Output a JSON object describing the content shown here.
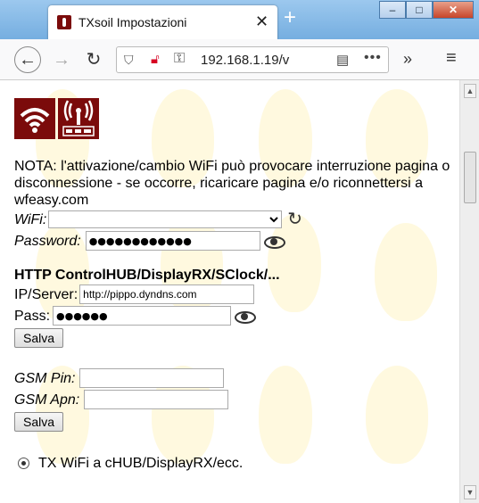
{
  "browser": {
    "tab_title": "TXsoil Impostazioni",
    "tab_close": "✕",
    "new_tab": "+",
    "url": "192.168.1.19/v",
    "win_minimize": "–",
    "win_maximize": "□",
    "win_close": "✕"
  },
  "page": {
    "note": "NOTA: l'attivazione/cambio WiFi può provocare interruzione pagina o disconnessione - se occorre, ricaricare pagina e/o riconnettersi a wfeasy.com",
    "wifi_label": "WiFi:",
    "wifi_value": "",
    "password_label": "Password:",
    "password_value": "●●●●●●●●●●●●",
    "http_heading": "HTTP ControlHUB/DisplayRX/SClock/...",
    "ip_label": "IP/Server:",
    "ip_value": "http://pippo.dyndns.com",
    "pass_label": "Pass:",
    "pass_value": "●●●●●●",
    "save_label": "Salva",
    "gsm_pin_label": "GSM Pin:",
    "gsm_pin_value": "",
    "gsm_apn_label": "GSM Apn:",
    "gsm_apn_value": "",
    "save2_label": "Salva",
    "radio_label": "TX WiFi a cHUB/DisplayRX/ecc."
  },
  "colors": {
    "brand": "#7b0b0b",
    "accent": "#3c9ae0"
  }
}
